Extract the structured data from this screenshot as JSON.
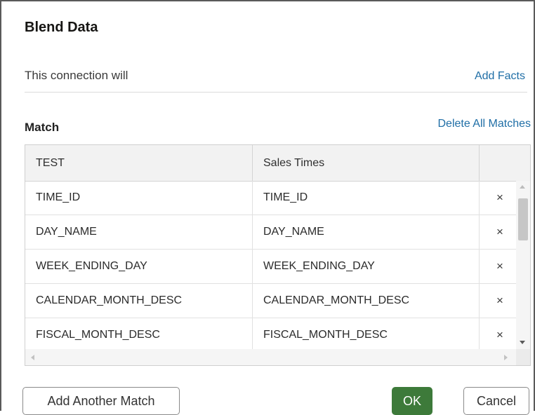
{
  "dialog": {
    "title": "Blend Data",
    "connection_label": "This connection will",
    "add_facts_link": "Add Facts",
    "match_label": "Match",
    "delete_all_link": "Delete All Matches"
  },
  "grid": {
    "columns": [
      "TEST",
      "Sales Times",
      ""
    ],
    "rows": [
      {
        "left": "TIME_ID",
        "right": "TIME_ID"
      },
      {
        "left": "DAY_NAME",
        "right": "DAY_NAME"
      },
      {
        "left": "WEEK_ENDING_DAY",
        "right": "WEEK_ENDING_DAY"
      },
      {
        "left": "CALENDAR_MONTH_DESC",
        "right": "CALENDAR_MONTH_DESC"
      },
      {
        "left": "FISCAL_MONTH_DESC",
        "right": "FISCAL_MONTH_DESC"
      }
    ],
    "remove_glyph": "×"
  },
  "buttons": {
    "add_another_match": "Add Another Match",
    "ok": "OK",
    "cancel": "Cancel"
  },
  "colors": {
    "link": "#1f6ea6",
    "primary_button": "#3d7a3a"
  }
}
